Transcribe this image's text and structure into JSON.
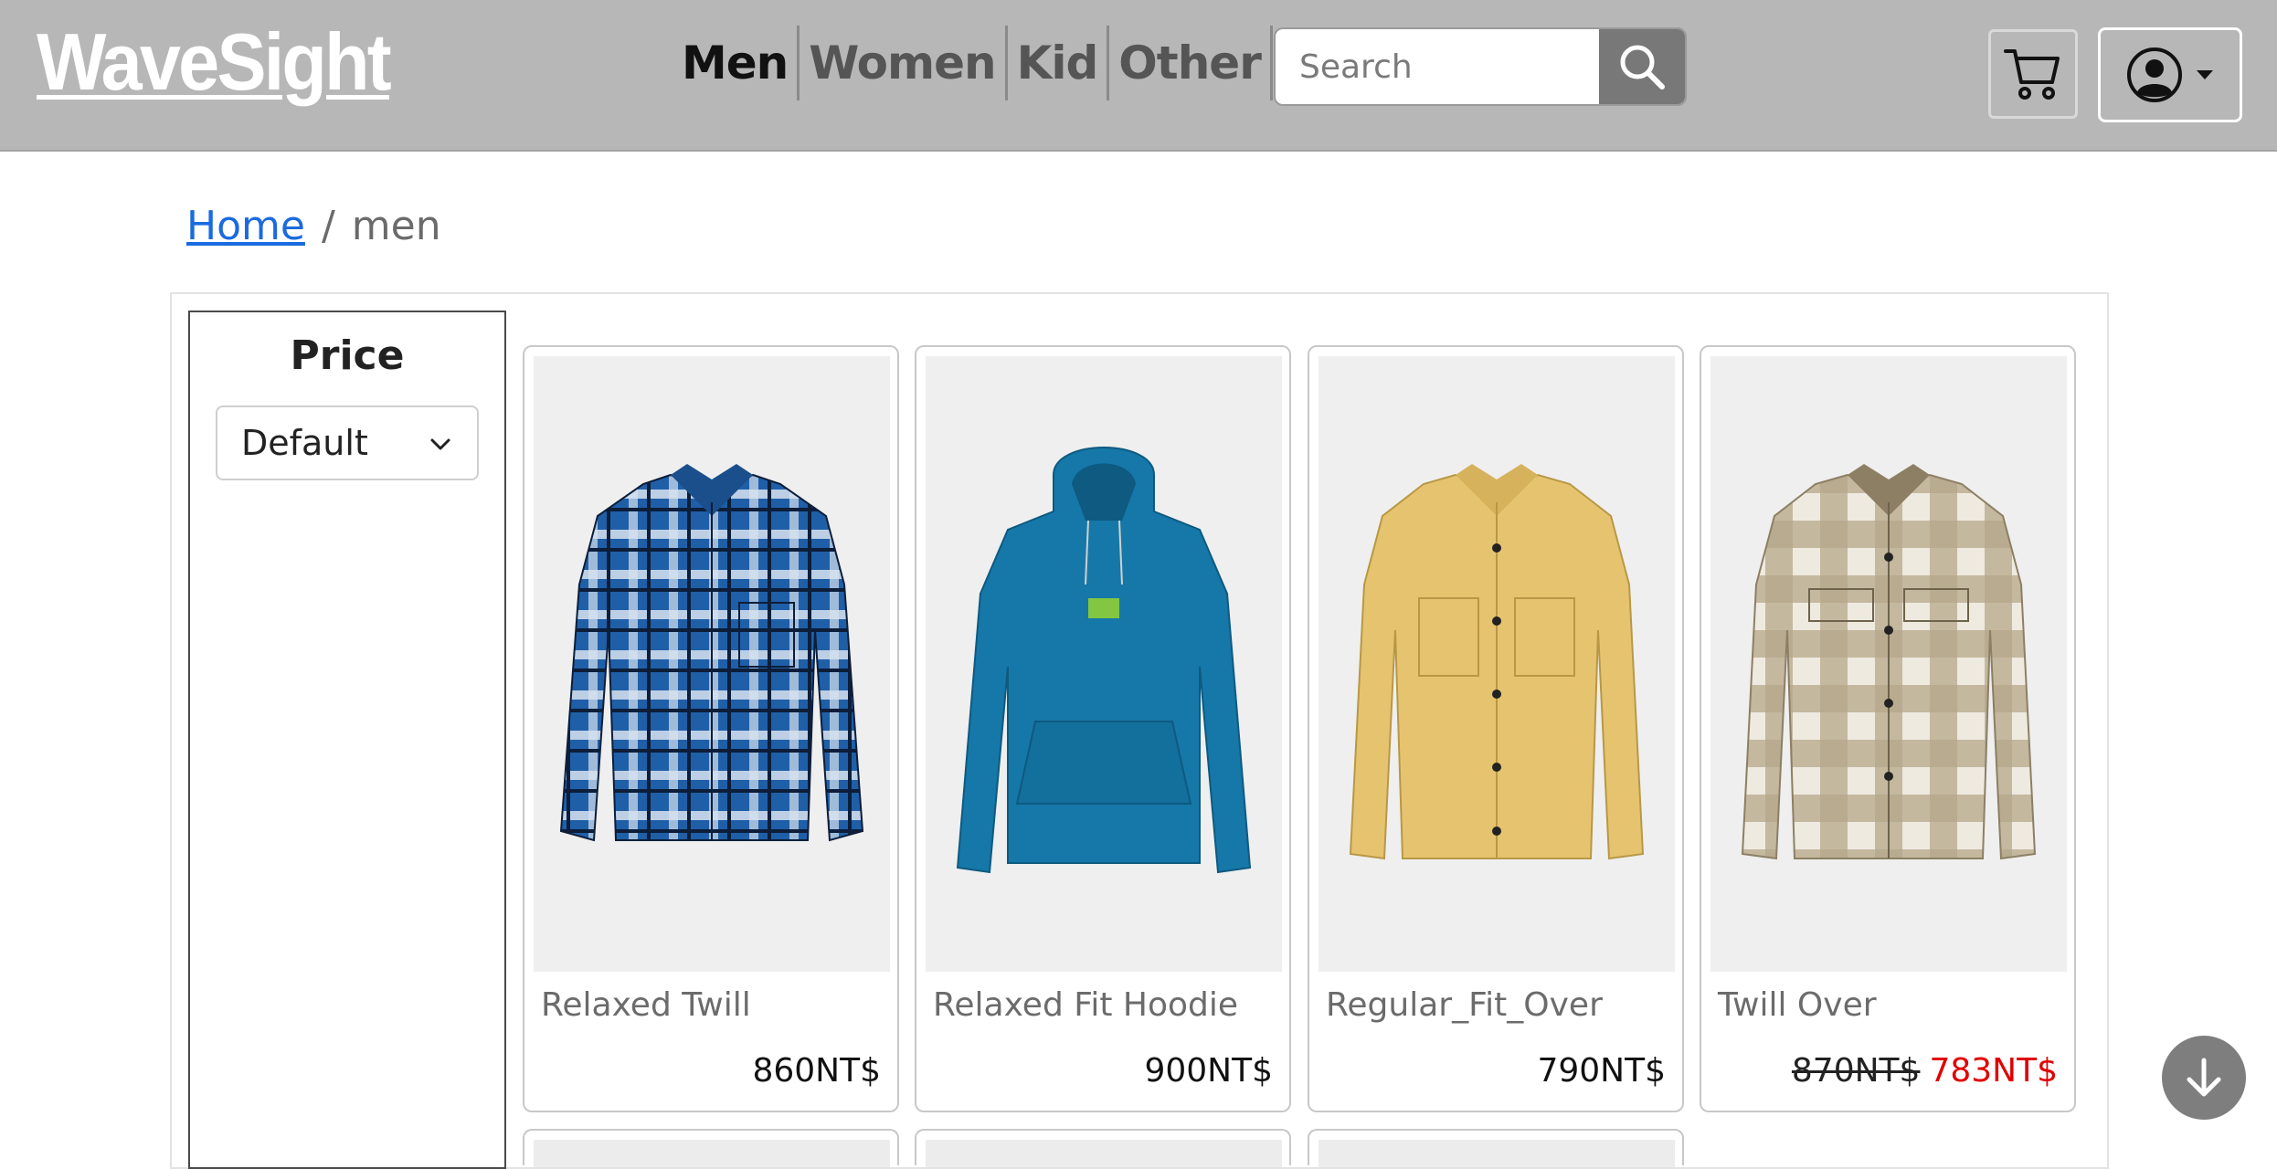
{
  "header": {
    "logo": "WaveSight",
    "nav": [
      "Men",
      "Women",
      "Kid",
      "Other"
    ],
    "active_nav": "Men",
    "search_placeholder": "Search"
  },
  "breadcrumb": {
    "home": "Home",
    "separator": "/",
    "current": "men"
  },
  "filter": {
    "title": "Price",
    "selected": "Default"
  },
  "products": [
    {
      "name": "Relaxed Twill",
      "price": "860NT$"
    },
    {
      "name": "Relaxed Fit Hoodie",
      "price": "900NT$"
    },
    {
      "name": "Regular_Fit_Over",
      "price": "790NT$"
    },
    {
      "name": "Twill Over",
      "old_price": "870NT$",
      "sale_price": "783NT$"
    }
  ],
  "icons": {
    "search": "search-icon",
    "cart": "cart-icon",
    "user": "user-icon",
    "dropdown": "chevron-down-icon",
    "scroll": "arrow-down-icon"
  },
  "colors": {
    "header_bg": "#b7b7b7",
    "link": "#1a6be0",
    "sale": "#e00000",
    "search_button": "#787878"
  }
}
